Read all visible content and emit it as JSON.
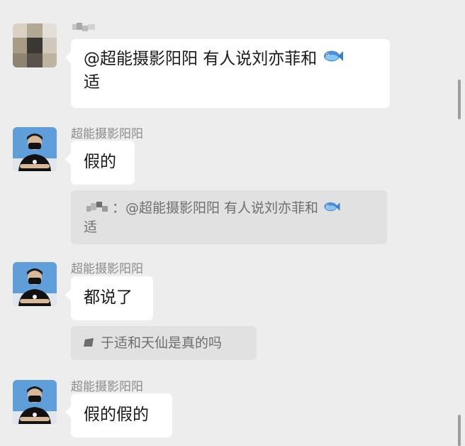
{
  "messages": [
    {
      "sender": "",
      "text_line1": "@超能摄影阳阳 有人说刘亦菲和",
      "emoji": "fish-emoji",
      "text_line2": "适"
    },
    {
      "sender": "超能摄影阳阳",
      "text": "假的",
      "quote": {
        "text_line1": "：@超能摄影阳阳 有人说刘亦菲和",
        "emoji": "fish-emoji",
        "text_line2": "适"
      }
    },
    {
      "sender": "超能摄影阳阳",
      "text": "都说了",
      "quote": {
        "text": "于适和天仙是真的吗"
      }
    },
    {
      "sender": "超能摄影阳阳",
      "text": "假的假的"
    }
  ],
  "colors": {
    "background": "#ededed",
    "bubble": "#ffffff",
    "quote_bg": "#e1e1e1",
    "sender_text": "#8c8c8c"
  }
}
